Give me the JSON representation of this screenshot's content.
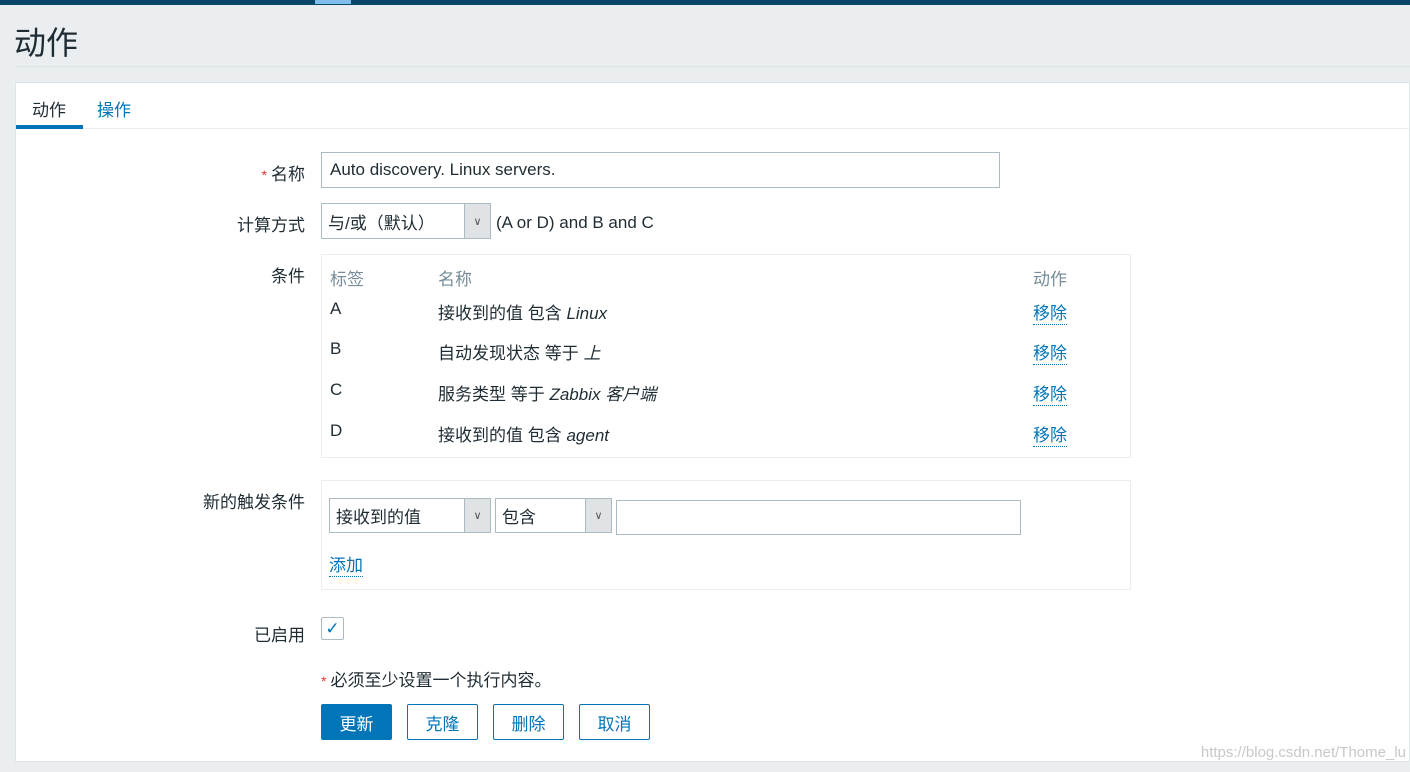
{
  "page": {
    "title": "动作"
  },
  "tabs": [
    {
      "label": "动作",
      "active": true
    },
    {
      "label": "操作",
      "active": false
    }
  ],
  "form": {
    "name_label": "名称",
    "required_mark": "*",
    "name_value": "Auto discovery. Linux servers.",
    "calc_label": "计算方式",
    "calc_selected": "与/或（默认）",
    "calc_expression": "(A or D) and B and C",
    "conditions_label": "条件",
    "conditions_headers": [
      "标签",
      "名称",
      "动作"
    ],
    "conditions": [
      {
        "label": "A",
        "name": "接收到的值 包含 ",
        "value": "Linux",
        "action": "移除"
      },
      {
        "label": "B",
        "name": "自动发现状态 等于 ",
        "value": "上",
        "action": "移除"
      },
      {
        "label": "C",
        "name": "服务类型 等于 ",
        "value": "Zabbix 客户端",
        "action": "移除"
      },
      {
        "label": "D",
        "name": "接收到的值 包含 ",
        "value": "agent",
        "action": "移除"
      }
    ],
    "new_condition_label": "新的触发条件",
    "new_condition_type": "接收到的值",
    "new_condition_operator": "包含",
    "new_condition_value": "",
    "add_label": "添加",
    "enabled_label": "已启用",
    "enabled": true,
    "warning": "必须至少设置一个执行内容。"
  },
  "buttons": {
    "update": "更新",
    "clone": "克隆",
    "delete": "删除",
    "cancel": "取消"
  },
  "watermark": "https://blog.csdn.net/Thome_lu",
  "colors": {
    "accent": "#0275b8",
    "header_bar": "#0a466a",
    "required": "#e33734"
  }
}
